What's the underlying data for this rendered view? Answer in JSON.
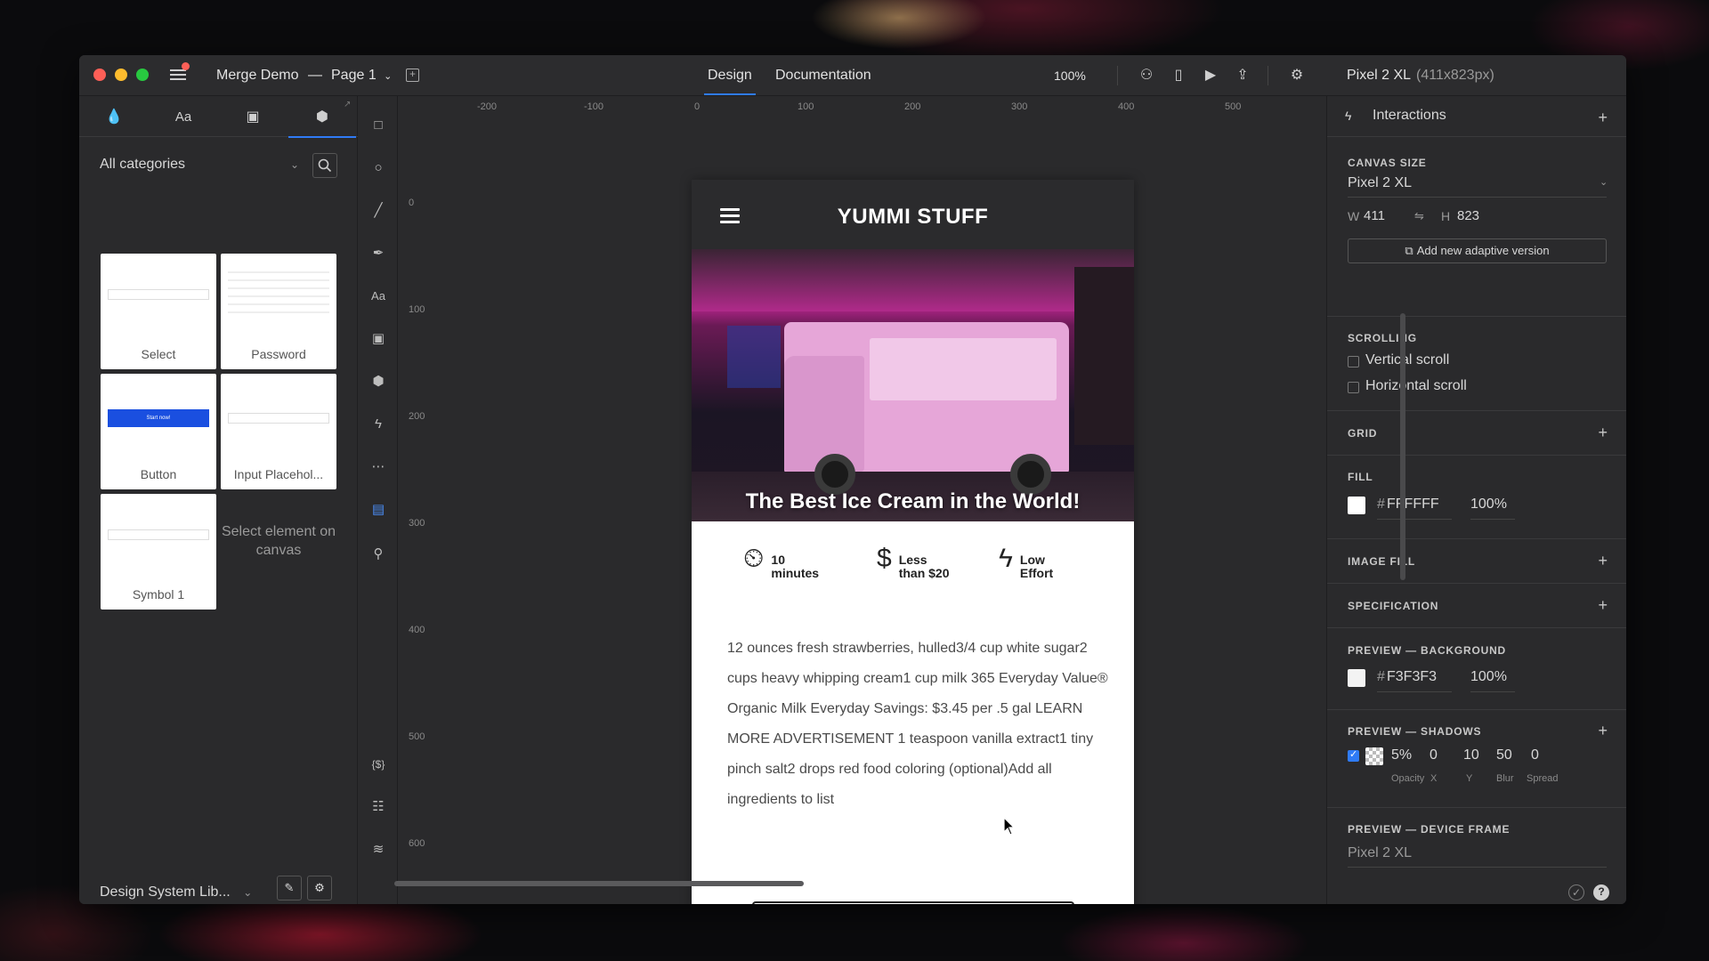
{
  "window": {
    "doc_title": "Merge Demo",
    "title_sep": "—",
    "page": "Page 1",
    "tabs": [
      "Design",
      "Documentation"
    ],
    "zoom": "100%",
    "device_name": "Pixel 2 XL",
    "device_size": "(411x823px)"
  },
  "left_panel": {
    "category": "All categories",
    "components": [
      {
        "label": "Select"
      },
      {
        "label": "Password"
      },
      {
        "label": "Button",
        "button_text": "Start now!"
      },
      {
        "label": "Input Placehol..."
      },
      {
        "label": "Symbol 1"
      }
    ],
    "empty_hint": "Select element on canvas",
    "library": "Design System Lib..."
  },
  "rulers": {
    "top": [
      "-200",
      "-100",
      "0",
      "100",
      "200",
      "300",
      "400",
      "500"
    ],
    "left": [
      "0",
      "100",
      "200",
      "300",
      "400",
      "500",
      "600"
    ]
  },
  "artboard": {
    "title": "YUMMI STUFF",
    "hero_caption": "The Best Ice Cream in the World!",
    "meta": [
      {
        "icon": "timer-icon",
        "line1": "10",
        "line2": "minutes"
      },
      {
        "icon": "dollar-icon",
        "line1": "Less",
        "line2": "than $20"
      },
      {
        "icon": "lightning-icon",
        "line1": "Low",
        "line2": "Effort"
      }
    ],
    "recipe": "12 ounces fresh strawberries, hulled3/4 cup white sugar2 cups heavy whipping cream1 cup milk 365 Everyday Value® Organic Milk Everyday Savings: $3.45 per .5 gal LEARN MORE ADVERTISEMENT 1 teaspoon vanilla extract1 tiny pinch salt2 drops red food coloring (optional)Add all ingredients to list"
  },
  "right_panel": {
    "interactions": "Interactions",
    "canvas_size_head": "CANVAS SIZE",
    "canvas_device": "Pixel 2 XL",
    "w_label": "W",
    "w_value": "411",
    "h_label": "H",
    "h_value": "823",
    "adaptive": "Add new adaptive version",
    "scrolling_head": "SCROLLING",
    "vertical_scroll": "Vertical scroll",
    "horizontal_scroll": "Horizontal scroll",
    "grid_head": "GRID",
    "fill_head": "FILL",
    "fill_hash": "#",
    "fill_hex": "FFFFFF",
    "fill_opacity": "100%",
    "image_fill_head": "IMAGE FILL",
    "spec_head": "SPECIFICATION",
    "preview_bg_head": "PREVIEW — BACKGROUND",
    "preview_bg_hash": "#",
    "preview_bg_hex": "F3F3F3",
    "preview_bg_opacity": "100%",
    "preview_shadows_head": "PREVIEW — SHADOWS",
    "shadow": {
      "opacity": "5%",
      "x": "0",
      "y": "10",
      "blur": "50",
      "spread": "0",
      "labels": [
        "Opacity",
        "X",
        "Y",
        "Blur",
        "Spread"
      ]
    },
    "preview_frame_head": "PREVIEW — DEVICE FRAME",
    "preview_frame_value": "Pixel 2 XL"
  },
  "colors": {
    "accent": "#2f7bf6",
    "fill": "#FFFFFF",
    "preview_bg": "#F3F3F3"
  }
}
